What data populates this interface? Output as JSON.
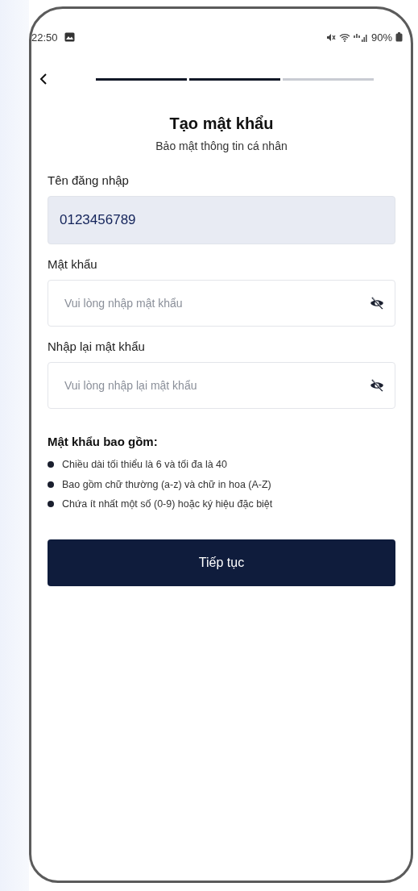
{
  "status_bar": {
    "time": "22:50",
    "battery": "90%"
  },
  "progress_steps": [
    {
      "completed": true
    },
    {
      "completed": true
    },
    {
      "completed": false
    }
  ],
  "title": "Tạo mật khẩu",
  "subtitle": "Bảo mật thông tin cá nhân",
  "fields": [
    {
      "label": "Tên đăng nhập",
      "value": "0123456789",
      "disabled": true,
      "kind": "text"
    },
    {
      "label": "Mật khẩu",
      "placeholder": "Vui lòng nhập mật khẩu",
      "disabled": false,
      "kind": "password"
    },
    {
      "label": "Nhập lại mật khẩu",
      "placeholder": "Vui lòng nhập lại mật khẩu",
      "disabled": false,
      "kind": "password"
    }
  ],
  "rules": {
    "heading": "Mật khẩu bao gồm:",
    "items": [
      "Chiều dài tối thiểu là 6 và tối đa là 40",
      "Bao gồm chữ thường (a-z) và chữ in hoa (A-Z)",
      "Chứa ít nhất một số (0-9) hoặc ký hiệu đặc biệt"
    ]
  },
  "continue_button": "Tiếp tục"
}
